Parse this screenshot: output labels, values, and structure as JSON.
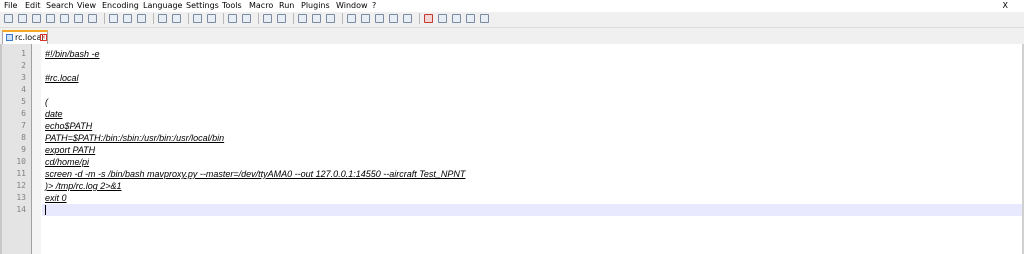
{
  "menu": {
    "items": [
      "File",
      "Edit",
      "Search",
      "View",
      "Encoding",
      "Language",
      "Settings",
      "Tools",
      "Macro",
      "Run",
      "Plugins",
      "Window",
      "?"
    ],
    "close": "X"
  },
  "toolbar": {
    "icons": [
      "new-file",
      "open-file",
      "save",
      "save-all",
      "close",
      "close-all",
      "print",
      "cut",
      "copy",
      "paste",
      "undo",
      "redo",
      "find",
      "replace",
      "zoom-in",
      "zoom-out",
      "sync-vertical",
      "sync-horizontal",
      "word-wrap",
      "show-all-chars",
      "indent-guide",
      "language-define",
      "document-map",
      "function-list",
      "folder-workspace",
      "monitoring",
      "record-macro",
      "stop-recording",
      "play-macro",
      "run-macro-multiple",
      "save-macro"
    ]
  },
  "tab": {
    "label": "rc.local"
  },
  "editor": {
    "line_numbers": [
      "1",
      "2",
      "3",
      "4",
      "5",
      "6",
      "7",
      "8",
      "9",
      "10",
      "11",
      "12",
      "13",
      "14"
    ],
    "lines": [
      "#!/bin/bash -e",
      "",
      "#rc.local",
      "",
      "(",
      "date",
      "echo$PATH",
      "PATH=$PATH:/bin:/sbin:/usr/bin:/usr/local/bin",
      "export PATH",
      "cd/home/pi",
      "screen -d -m -s /bin/bash mavproxy.py --master=/dev/ttyAMA0 --out 127.0.0.1:14550 --aircraft Test_NPNT",
      ")> /tmp/rc.log 2>&1",
      "exit 0",
      ""
    ],
    "current_line": 14
  }
}
